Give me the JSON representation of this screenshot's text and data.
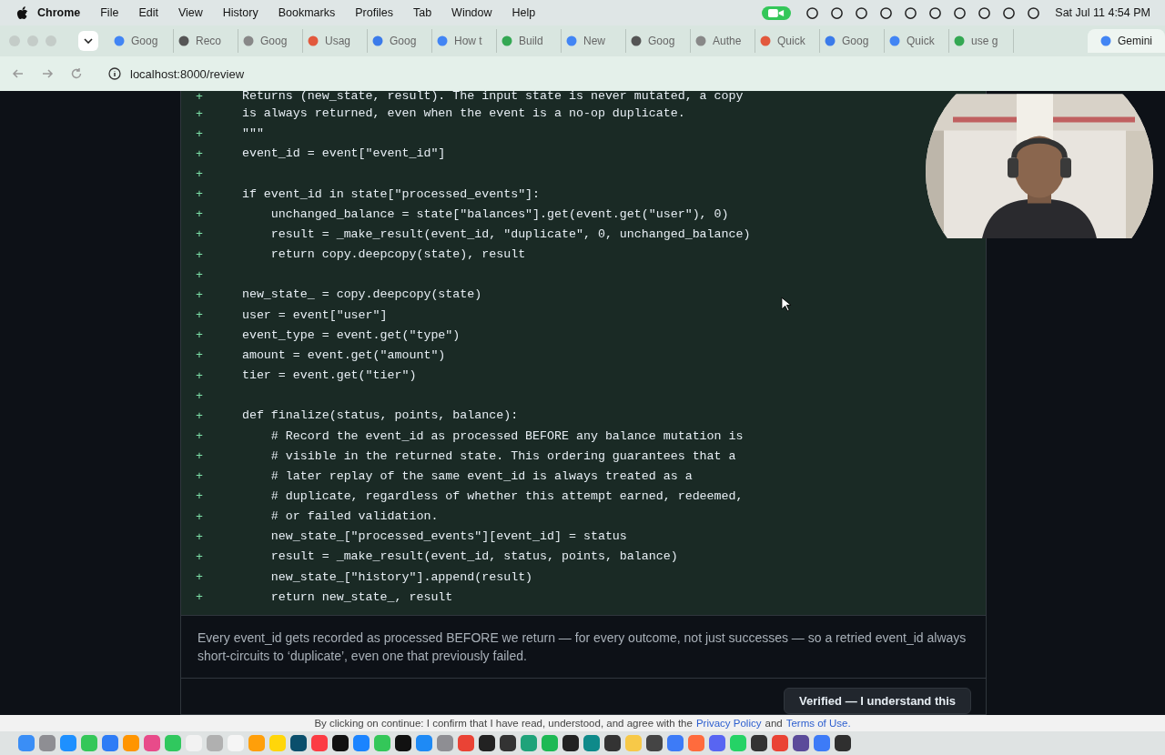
{
  "menu_bar": {
    "app": "Chrome",
    "items": [
      "File",
      "Edit",
      "View",
      "History",
      "Bookmarks",
      "Profiles",
      "Tab",
      "Window",
      "Help"
    ],
    "clock": "Sat Jul 11  4:54 PM"
  },
  "tabs": [
    {
      "label": "Goog",
      "selected": false
    },
    {
      "label": "Reco",
      "selected": false
    },
    {
      "label": "Goog",
      "selected": false
    },
    {
      "label": "Usag",
      "selected": false
    },
    {
      "label": "Goog",
      "selected": false
    },
    {
      "label": "How t",
      "selected": false
    },
    {
      "label": "Build",
      "selected": false
    },
    {
      "label": "New",
      "selected": false
    },
    {
      "label": "Goog",
      "selected": false
    },
    {
      "label": "Authe",
      "selected": false
    },
    {
      "label": "Quick",
      "selected": false
    },
    {
      "label": "Goog",
      "selected": false
    },
    {
      "label": "Quick",
      "selected": false
    },
    {
      "label": "use g",
      "selected": false
    },
    {
      "label": "Gemini",
      "selected": true
    }
  ],
  "address_bar": {
    "url": "localhost:8000/review"
  },
  "diff": {
    "lines": [
      {
        "marker": "+",
        "code": "    Returns (new_state, result). The input state is never mutated, a copy"
      },
      {
        "marker": "+",
        "code": "    is always returned, even when the event is a no-op duplicate."
      },
      {
        "marker": "+",
        "code": "    \"\"\""
      },
      {
        "marker": "+",
        "code": "    event_id = event[\"event_id\"]"
      },
      {
        "marker": "+"
      },
      {
        "marker": "+",
        "code": "    if event_id in state[\"processed_events\"]:"
      },
      {
        "marker": "+",
        "code": "        unchanged_balance = state[\"balances\"].get(event.get(\"user\"), 0)"
      },
      {
        "marker": "+",
        "code": "        result = _make_result(event_id, \"duplicate\", 0, unchanged_balance)"
      },
      {
        "marker": "+",
        "code": "        return copy.deepcopy(state), result"
      },
      {
        "marker": "+"
      },
      {
        "marker": "+",
        "code": "    new_state_ = copy.deepcopy(state)"
      },
      {
        "marker": "+",
        "code": "    user = event[\"user\"]"
      },
      {
        "marker": "+",
        "code": "    event_type = event.get(\"type\")"
      },
      {
        "marker": "+",
        "code": "    amount = event.get(\"amount\")"
      },
      {
        "marker": "+",
        "code": "    tier = event.get(\"tier\")"
      },
      {
        "marker": "+"
      },
      {
        "marker": "+",
        "code": "    def finalize(status, points, balance):"
      },
      {
        "marker": "+",
        "code": "        # Record the event_id as processed BEFORE any balance mutation is"
      },
      {
        "marker": "+",
        "code": "        # visible in the returned state. This ordering guarantees that a"
      },
      {
        "marker": "+",
        "code": "        # later replay of the same event_id is always treated as a"
      },
      {
        "marker": "+",
        "code": "        # duplicate, regardless of whether this attempt earned, redeemed,"
      },
      {
        "marker": "+",
        "code": "        # or failed validation."
      },
      {
        "marker": "+",
        "code": "        new_state_[\"processed_events\"][event_id] = status"
      },
      {
        "marker": "+",
        "code": "        result = _make_result(event_id, status, points, balance)"
      },
      {
        "marker": "+",
        "code": "        new_state_[\"history\"].append(result)"
      },
      {
        "marker": "+",
        "code": "        return new_state_, result"
      }
    ]
  },
  "note": "Every event_id gets recorded as processed BEFORE we return — for every outcome, not just successes — so a retried event_id always short-circuits to ‘duplicate’, even one that previously failed.",
  "verify_button": "Verified — I understand this",
  "consent": {
    "text": "By clicking on continue: I confirm that I have read, understood, and agree with the",
    "privacy_link": "Privacy Policy",
    "and": "and",
    "terms_link": "Terms of Use."
  }
}
